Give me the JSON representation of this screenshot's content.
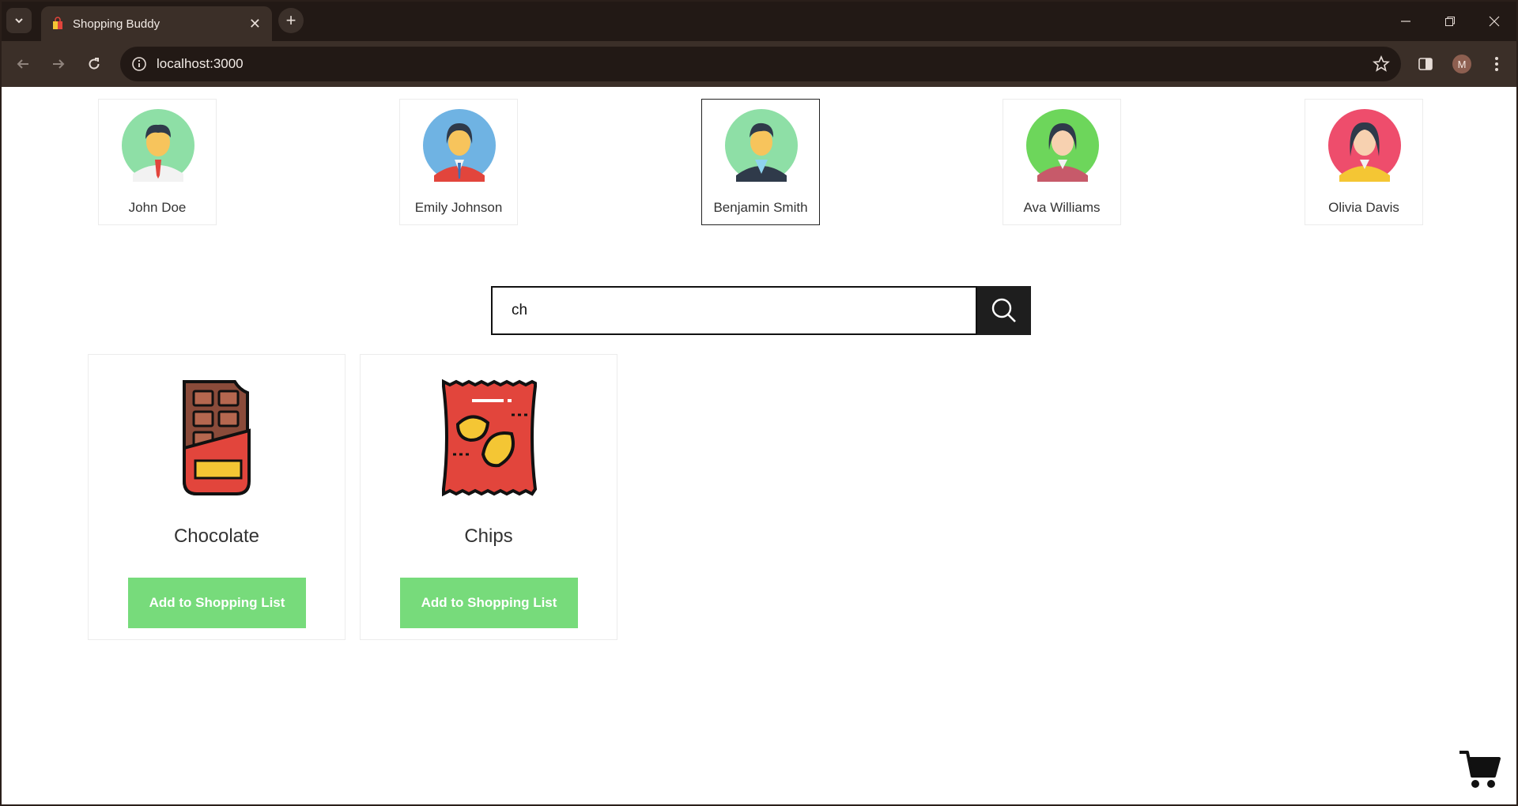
{
  "browser": {
    "tab_title": "Shopping Buddy",
    "url": "localhost:3000",
    "profile_initial": "M"
  },
  "users": [
    {
      "name": "John Doe",
      "bg_color": "#8edfa6",
      "selected": false
    },
    {
      "name": "Emily Johnson",
      "bg_color": "#6fb3e3",
      "selected": false
    },
    {
      "name": "Benjamin Smith",
      "bg_color": "#8edfa6",
      "selected": true
    },
    {
      "name": "Ava Williams",
      "bg_color": "#6dd65b",
      "selected": false
    },
    {
      "name": "Olivia Davis",
      "bg_color": "#ee4d6c",
      "selected": false
    }
  ],
  "search": {
    "value": "ch",
    "icon": "search-icon"
  },
  "products": [
    {
      "name": "Chocolate",
      "icon": "chocolate-bar-icon",
      "button_label": "Add to Shopping List"
    },
    {
      "name": "Chips",
      "icon": "chips-bag-icon",
      "button_label": "Add to Shopping List"
    }
  ],
  "colors": {
    "add_button": "#77db7b",
    "search_button": "#1e1e1e",
    "browser_frame": "#3b2f28"
  },
  "cart": {
    "icon": "shopping-cart-icon"
  }
}
